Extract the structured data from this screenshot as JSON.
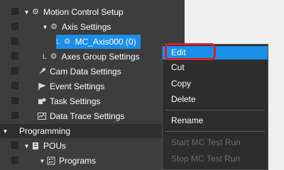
{
  "tree": {
    "motion_control_setup": "Motion Control Setup",
    "axis_settings": "Axis Settings",
    "mc_axis": "MC_Axis000 (0)",
    "axes_group_settings": "Axes Group Settings",
    "cam_data_settings": "Cam Data Settings",
    "event_settings": "Event Settings",
    "task_settings": "Task Settings",
    "data_trace_settings": "Data Trace Settings",
    "programming": "Programming",
    "pous": "POUs",
    "programs": "Programs"
  },
  "context_menu": {
    "edit": "Edit",
    "cut": "Cut",
    "copy": "Copy",
    "delete": "Delete",
    "rename": "Rename",
    "start_mc_test_run": "Start MC Test Run",
    "stop_mc_test_run": "Stop MC Test Run"
  },
  "colors": {
    "selection": "#1b8ee8",
    "focus_ring": "#d5202f",
    "tree_background": "#3d3d3d",
    "menu_background": "#2d2d2d"
  }
}
